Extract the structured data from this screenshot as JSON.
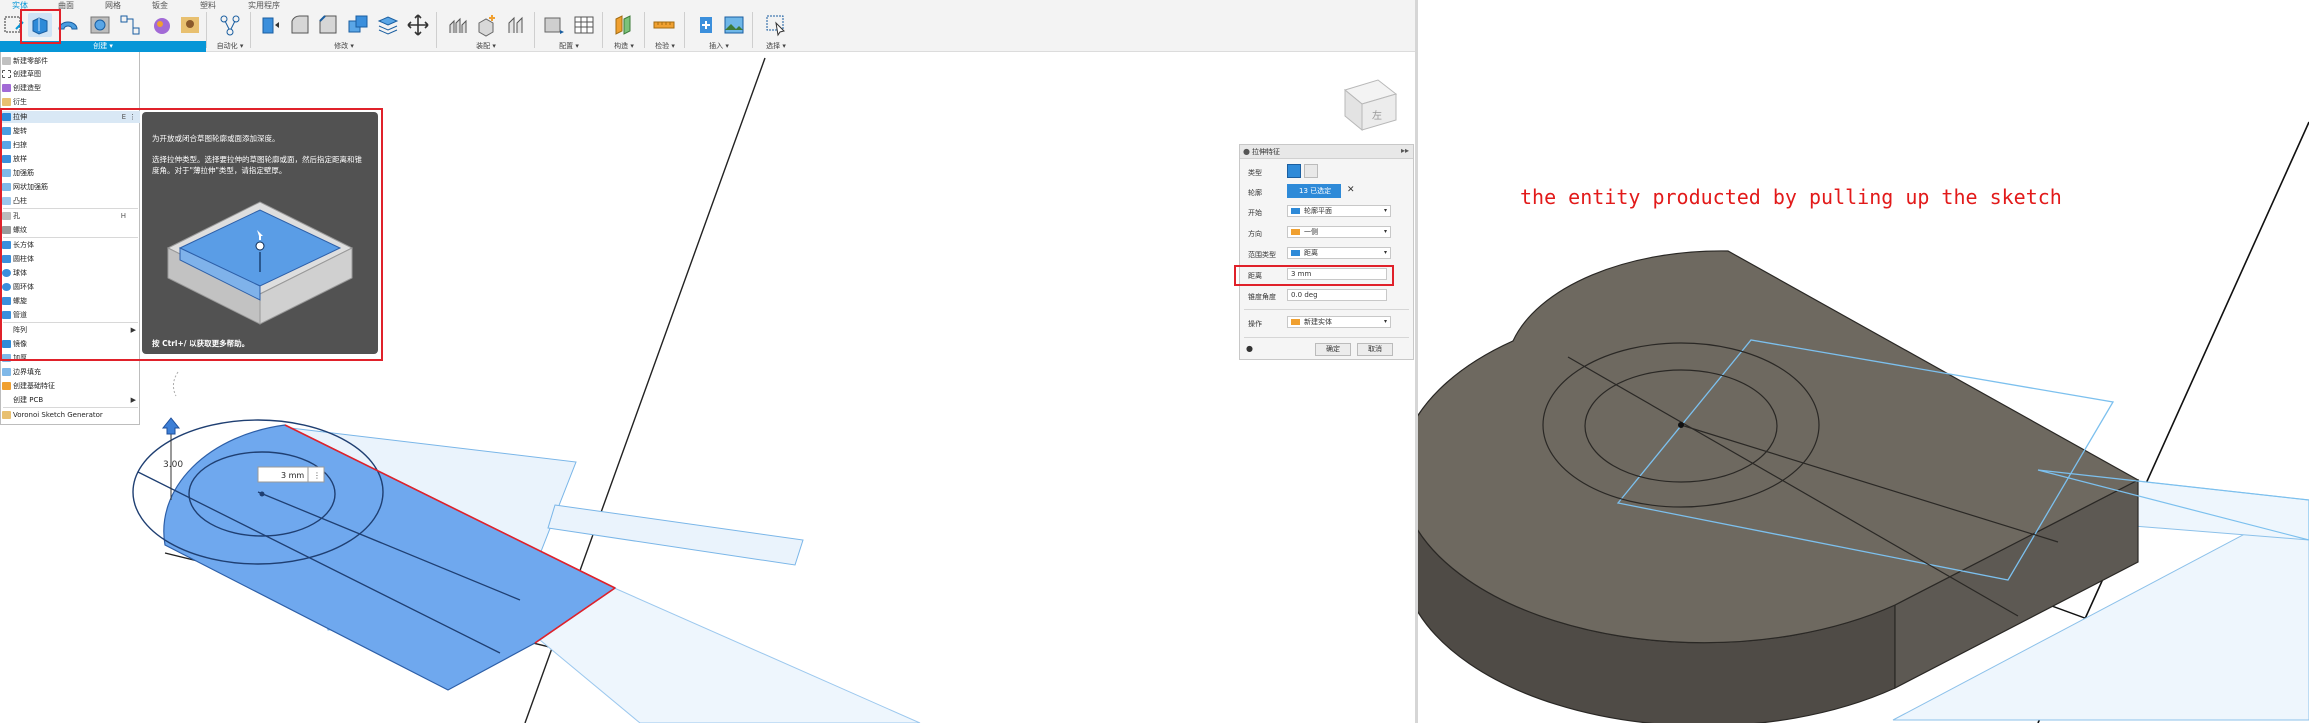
{
  "toolbar": {
    "tabs": [
      {
        "label": "实体",
        "active": true
      },
      {
        "label": "曲面"
      },
      {
        "label": "网格"
      },
      {
        "label": "钣金"
      },
      {
        "label": "塑料"
      },
      {
        "label": "实用程序"
      }
    ],
    "groups": {
      "create": "创建 ▾",
      "modify": "修改 ▾",
      "automate": "自动化 ▾",
      "assemble": "装配 ▾",
      "configure": "配置 ▾",
      "construct": "构造 ▾",
      "inspect": "检验 ▾",
      "insert": "插入 ▾",
      "select": "选择 ▾"
    }
  },
  "create_menu": {
    "items": [
      "新建零部件",
      "创建草图",
      "创建造型",
      "衍生",
      "拉伸",
      "旋转",
      "扫掠",
      "放样",
      "加强筋",
      "网状加强筋",
      "凸柱",
      "孔",
      "螺纹",
      "长方体",
      "圆柱体",
      "球体",
      "圆环体",
      "螺旋",
      "管道",
      "阵列",
      "镜像",
      "加厚",
      "边界填充",
      "创建基础特征",
      "创建 PCB",
      "Voronoi Sketch Generator"
    ],
    "extrude_shortcut": "E",
    "hole_shortcut": "H"
  },
  "tooltip": {
    "line1": "为开放或闭合草图轮廓或面添加深度。",
    "line2": "选择拉伸类型。选择要拉伸的草图轮廓或面，然后指定距离和锥度角。对于\"薄拉伸\"类型，请指定壁厚。",
    "footer": "按 Ctrl+/ 以获取更多帮助。"
  },
  "dialog": {
    "title": "拉伸特征",
    "rows": {
      "type_label": "类型",
      "profile_label": "轮廓",
      "profile_value": "13 已选定",
      "start_label": "开始",
      "start_value": "轮廓平面",
      "direction_label": "方向",
      "direction_value": "一侧",
      "extent_label": "范围类型",
      "extent_value": "距离",
      "distance_label": "距离",
      "distance_value": "3 mm",
      "taper_label": "锥度角度",
      "taper_value": "0.0 deg",
      "operation_label": "操作",
      "operation_value": "新建实体"
    },
    "ok": "确定",
    "cancel": "取消"
  },
  "canvas": {
    "dimension_label": "3 mm",
    "manipulator_value": "3.00",
    "viewcube_label": "左"
  },
  "caption": "the entity producted by pulling up the sketch",
  "colors": {
    "accent": "#0696d7",
    "highlight": "#e0212a",
    "preview_fill": "#6fa8ee",
    "solid_top": "#6b665e",
    "solid_side": "#4a4641"
  }
}
